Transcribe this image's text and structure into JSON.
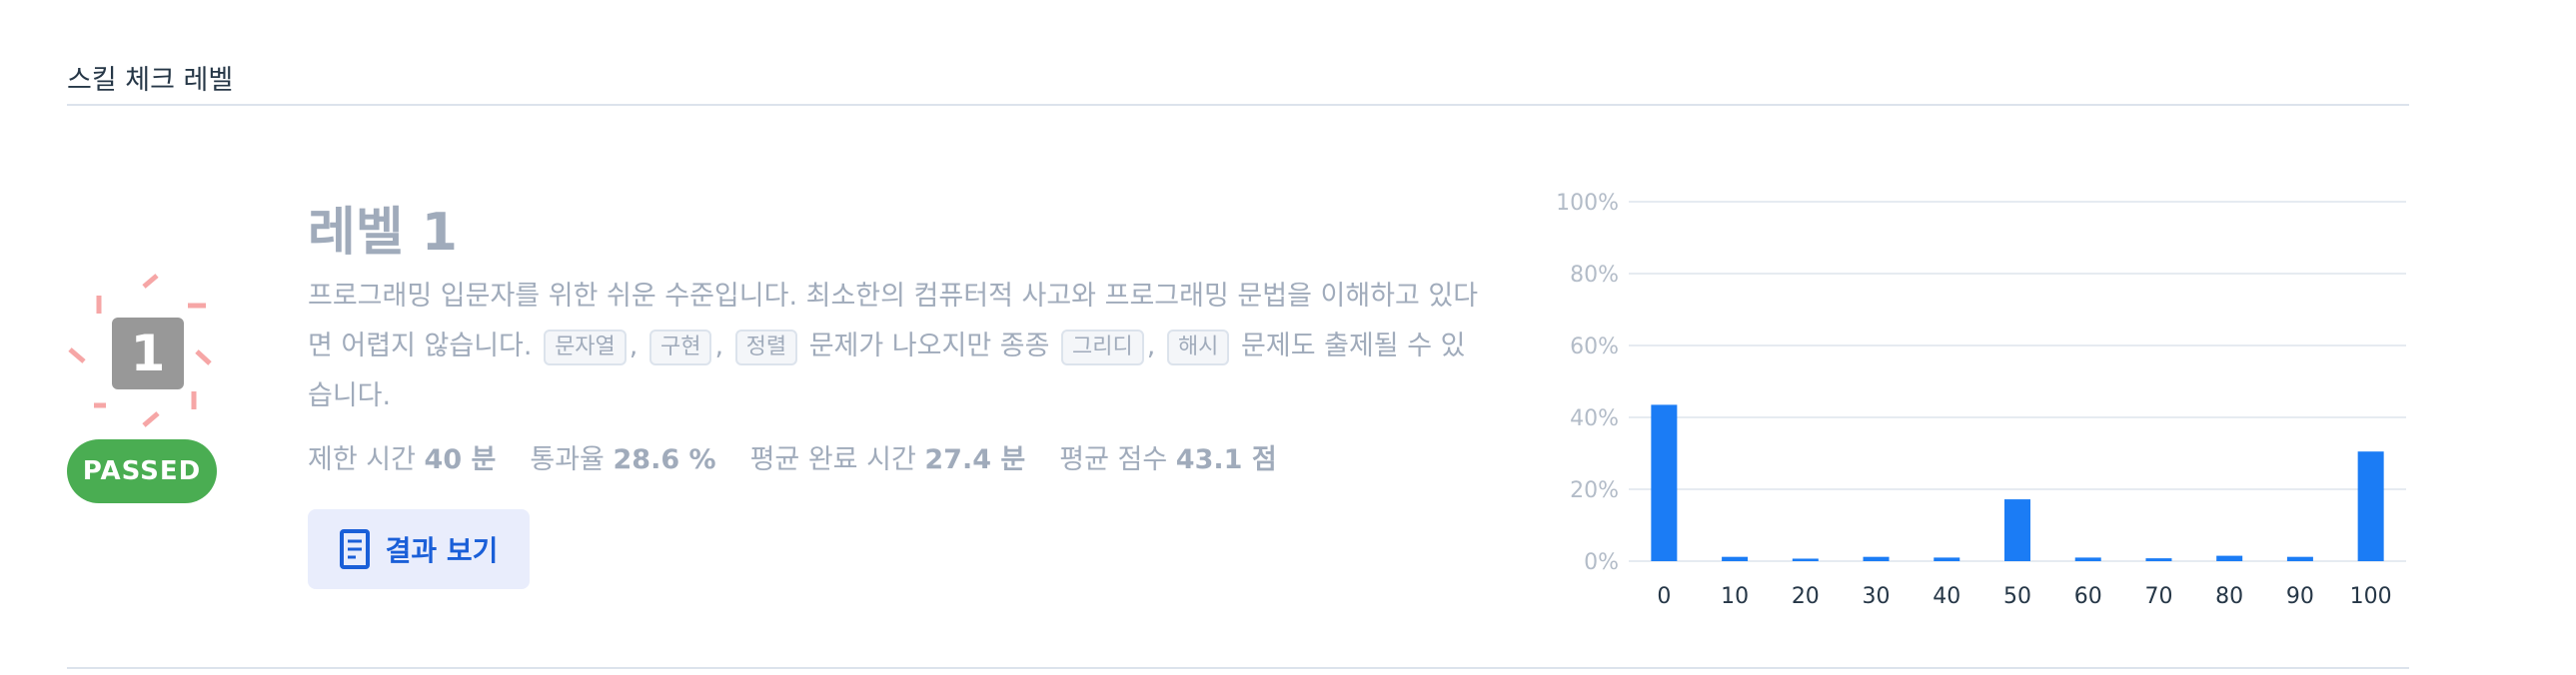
{
  "section": {
    "title": "스킬 체크 레벨"
  },
  "level": {
    "number": "1",
    "status": "PASSED",
    "title": "레벨 1",
    "desc_part1": "프로그래밍 입문자를 위한 쉬운 수준입니다. 최소한의 컴퓨터적 사고와 프로그래밍 문법을 이해하고 있다면 어렵지 않습니다.",
    "tags": [
      "문자열",
      "구현",
      "정렬",
      "그리디",
      "해시"
    ],
    "desc_part2": "문제가 나오지만 종종",
    "desc_part3": "문제도 출제될 수 있습니다."
  },
  "stats": {
    "time_label": "제한 시간",
    "time_value": "40 분",
    "pass_label": "통과율",
    "pass_value": "28.6 %",
    "avg_time_label": "평균 완료 시간",
    "avg_time_value": "27.4 분",
    "avg_score_label": "평균 점수",
    "avg_score_value": "43.1 점"
  },
  "result_button": {
    "label": "결과 보기",
    "icon": "document-icon"
  },
  "colors": {
    "bar": "#1b7cf5",
    "passed": "#4aad52",
    "rays": "#f6a6a6"
  },
  "chart_data": {
    "type": "bar",
    "categories": [
      "0",
      "10",
      "20",
      "30",
      "40",
      "50",
      "60",
      "70",
      "80",
      "90",
      "100"
    ],
    "values": [
      43.5,
      1.2,
      0.7,
      1.2,
      1.0,
      17.2,
      1.0,
      0.8,
      1.5,
      1.2,
      30.5
    ],
    "yticks": [
      "0%",
      "20%",
      "40%",
      "60%",
      "80%",
      "100%"
    ],
    "ylim": [
      0,
      100
    ],
    "grid": true
  }
}
